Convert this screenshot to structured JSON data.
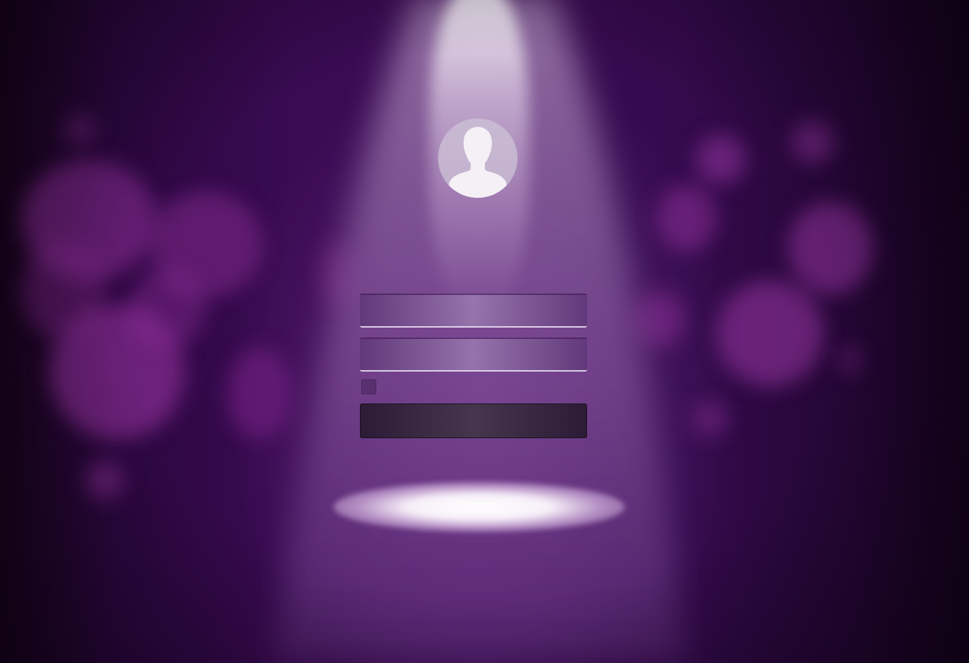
{
  "login": {
    "username": {
      "value": "",
      "placeholder": ""
    },
    "password": {
      "value": "",
      "placeholder": ""
    },
    "remember": {
      "label": "",
      "checked": false
    },
    "submit": {
      "label": ""
    }
  },
  "icons": {
    "avatar": "user-silhouette-icon"
  },
  "colors": {
    "background": "#3a0a52",
    "bokeh": "#8a2a9a",
    "spotlight": "#ffffff",
    "field": "#7a5596",
    "field_underline": "#e6d7f0",
    "checkbox": "#5a2f70",
    "button": "#3a2a44"
  }
}
